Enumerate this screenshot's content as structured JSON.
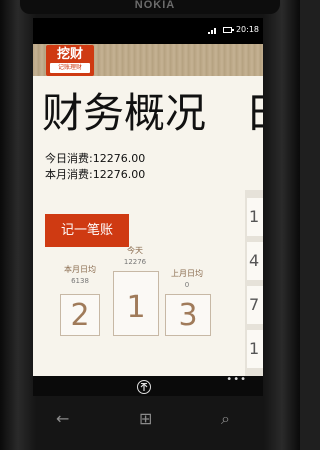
{
  "device": {
    "brand": "NOKIA"
  },
  "status_bar": {
    "time": "20:18"
  },
  "app": {
    "logo": {
      "main": "挖财",
      "sub": "记账理财"
    },
    "page_title": "财务概况",
    "next_page_title_peek": "日",
    "today_expense": "今日消费:12276.00",
    "month_expense": "本月消费:12276.00",
    "add_button_label": "记一笔账",
    "side_digits": [
      "1",
      "4",
      "7",
      "1"
    ],
    "stats": [
      {
        "label": "本月日均",
        "value": "6138",
        "digit": "2"
      },
      {
        "label": "今天",
        "value": "12276",
        "digit": "1"
      },
      {
        "label": "上月日均",
        "value": "0",
        "digit": "3"
      }
    ]
  },
  "app_bar": {
    "more_label": "•••"
  },
  "hardware_buttons": {
    "back": "←",
    "start": "⊞",
    "search": "⌕"
  },
  "colors": {
    "accent": "#cf3a12",
    "app_background": "#f7f4ec",
    "header_wood": "#b9a585"
  }
}
